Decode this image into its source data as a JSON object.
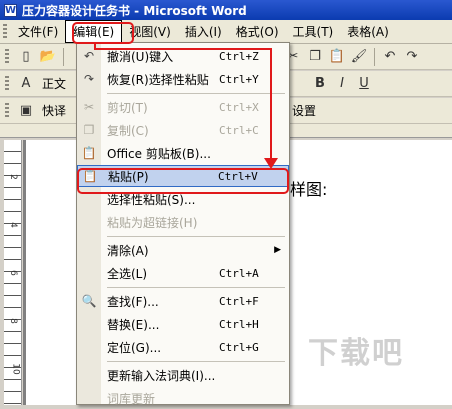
{
  "window": {
    "title": "压力容器设计任务书 - Microsoft Word",
    "app_icon": "W"
  },
  "menubar": [
    "文件(F)",
    "编辑(E)",
    "视图(V)",
    "插入(I)",
    "格式(O)",
    "工具(T)",
    "表格(A)"
  ],
  "toolbar1": {
    "font_style": "正文",
    "bold": "B",
    "italic": "I",
    "underline": "U"
  },
  "toolbar2": {
    "quick": "快译",
    "settings": "设置"
  },
  "document": {
    "text": "样图:"
  },
  "edit_menu": {
    "items": [
      {
        "label": "撤消(U)键入",
        "shortcut": "Ctrl+Z",
        "icon": "undo-icon",
        "glyph": "↶",
        "disabled": false
      },
      {
        "label": "恢复(R)选择性粘贴",
        "shortcut": "Ctrl+Y",
        "icon": "redo-icon",
        "glyph": "↷",
        "disabled": false
      },
      {
        "label": "剪切(T)",
        "shortcut": "Ctrl+X",
        "icon": "scissors-icon",
        "glyph": "✂",
        "disabled": true
      },
      {
        "label": "复制(C)",
        "shortcut": "Ctrl+C",
        "icon": "copy-icon",
        "glyph": "❐",
        "disabled": true
      },
      {
        "label": "Office 剪贴板(B)...",
        "shortcut": "",
        "icon": "clipboard-icon",
        "glyph": "📋",
        "disabled": false
      },
      {
        "label": "粘贴(P)",
        "shortcut": "Ctrl+V",
        "icon": "paste-icon",
        "glyph": "📋",
        "disabled": false,
        "highlighted": true
      },
      {
        "label": "选择性粘贴(S)...",
        "shortcut": "",
        "icon": "",
        "glyph": "",
        "disabled": false
      },
      {
        "label": "粘贴为超链接(H)",
        "shortcut": "",
        "icon": "",
        "glyph": "",
        "disabled": true
      },
      {
        "label": "清除(A)",
        "shortcut": "",
        "icon": "",
        "glyph": "",
        "disabled": false,
        "submenu": true
      },
      {
        "label": "全选(L)",
        "shortcut": "Ctrl+A",
        "icon": "",
        "glyph": "",
        "disabled": false
      },
      {
        "label": "查找(F)...",
        "shortcut": "Ctrl+F",
        "icon": "find-icon",
        "glyph": "🔍",
        "disabled": false
      },
      {
        "label": "替换(E)...",
        "shortcut": "Ctrl+H",
        "icon": "",
        "glyph": "",
        "disabled": false
      },
      {
        "label": "定位(G)...",
        "shortcut": "Ctrl+G",
        "icon": "",
        "glyph": "",
        "disabled": false
      },
      {
        "label": "更新输入法词典(I)...",
        "shortcut": "",
        "icon": "",
        "glyph": "",
        "disabled": false
      },
      {
        "label": "词库更新",
        "shortcut": "",
        "icon": "",
        "glyph": "",
        "disabled": true
      }
    ]
  },
  "ruler_numbers": [
    "2",
    "4",
    "6",
    "8",
    "10"
  ],
  "watermark": "下载吧",
  "colors": {
    "annotation_red": "#e0191b",
    "highlight": "#c1d2ee",
    "title_blue": "#0b3bb0"
  }
}
